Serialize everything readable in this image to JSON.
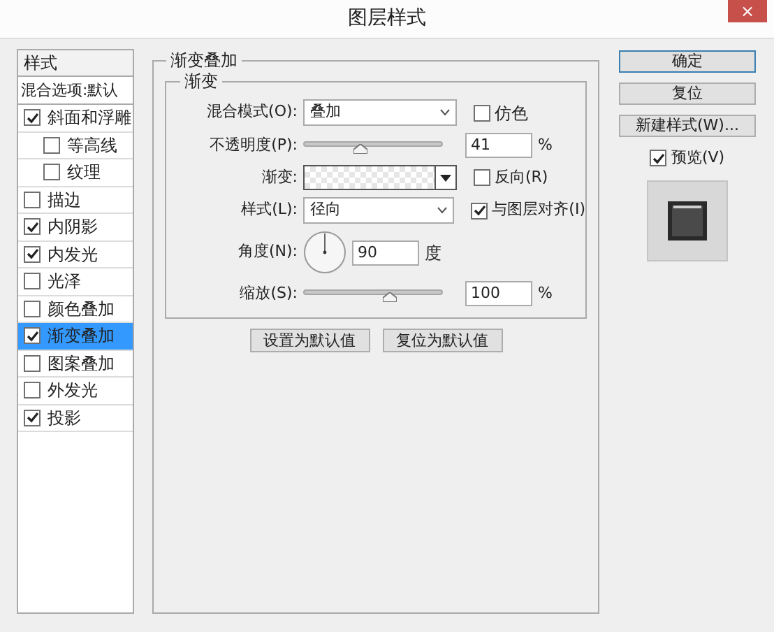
{
  "window": {
    "title": "图层样式",
    "close": "×"
  },
  "sidebar": {
    "header": "样式",
    "blend_options": "混合选项:默认",
    "items": [
      {
        "label": "斜面和浮雕",
        "checked": true,
        "selected": false,
        "children": [
          {
            "label": "等高线",
            "checked": false,
            "selected": false
          },
          {
            "label": "纹理",
            "checked": false,
            "selected": false
          }
        ]
      },
      {
        "label": "描边",
        "checked": false,
        "selected": false
      },
      {
        "label": "内阴影",
        "checked": true,
        "selected": false
      },
      {
        "label": "内发光",
        "checked": true,
        "selected": false
      },
      {
        "label": "光泽",
        "checked": false,
        "selected": false
      },
      {
        "label": "颜色叠加",
        "checked": false,
        "selected": false
      },
      {
        "label": "渐变叠加",
        "checked": true,
        "selected": true
      },
      {
        "label": "图案叠加",
        "checked": false,
        "selected": false
      },
      {
        "label": "外发光",
        "checked": false,
        "selected": false
      },
      {
        "label": "投影",
        "checked": true,
        "selected": false
      }
    ]
  },
  "panel": {
    "title": "渐变叠加",
    "group_title": "渐变",
    "blend_mode": {
      "label": "混合模式(O):",
      "value": "叠加"
    },
    "dither": {
      "label": "仿色",
      "checked": false
    },
    "opacity": {
      "label": "不透明度(P):",
      "level": 0.41,
      "value": "41",
      "unit": "%"
    },
    "gradient": {
      "label": "渐变:"
    },
    "reverse": {
      "label": "反向(R)",
      "checked": false
    },
    "style": {
      "label": "样式(L):",
      "value": "径向"
    },
    "align": {
      "label": "与图层对齐(I)",
      "checked": true
    },
    "angle": {
      "label": "角度(N):",
      "value": "90",
      "unit": "度"
    },
    "scale": {
      "label": "缩放(S):",
      "level": 0.62,
      "value": "100",
      "unit": "%"
    },
    "buttons": [
      "设置为默认值",
      "复位为默认值"
    ]
  },
  "actions": {
    "buttons": [
      {
        "label": "确定",
        "selected": true
      },
      {
        "label": "复位",
        "selected": false
      },
      {
        "label": "新建样式(W)...",
        "selected": false
      }
    ],
    "preview": {
      "label": "预览(V)",
      "checked": true
    }
  }
}
